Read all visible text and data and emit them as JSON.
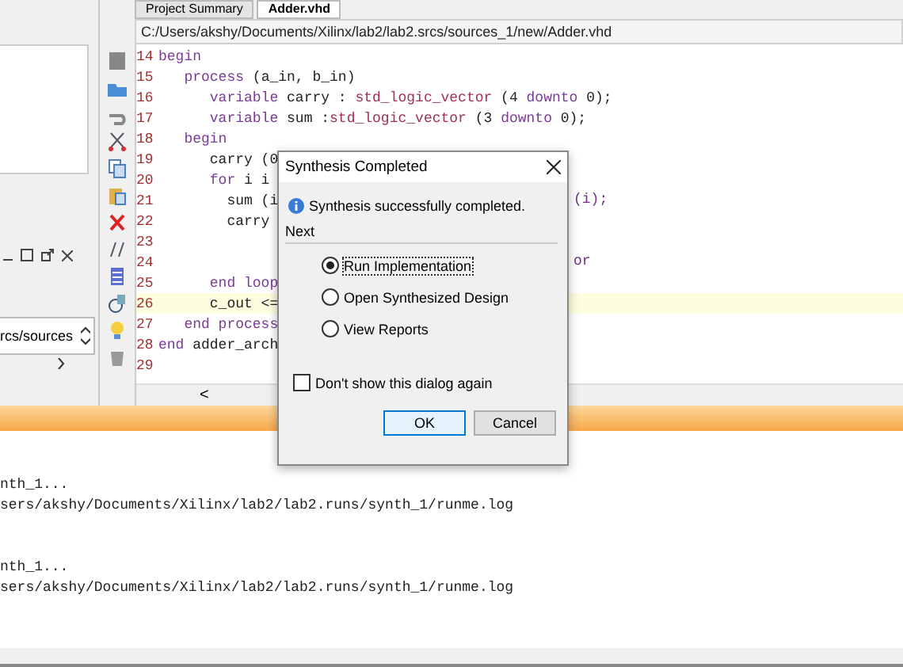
{
  "tabs": [
    {
      "label": "Project Summary",
      "selected": false
    },
    {
      "label": "Adder.vhd",
      "selected": true
    }
  ],
  "left_panel": {
    "field_value": "rcs/sources"
  },
  "editor": {
    "path": "C:/Users/akshy/Documents/Xilinx/lab2/lab2.srcs/sources_1/new/Adder.vhd",
    "lines": [
      {
        "number": "14",
        "highlighted": false,
        "segments": [
          {
            "text": "begin",
            "kind": "keyword"
          }
        ]
      },
      {
        "number": "15",
        "highlighted": false,
        "segments": [
          {
            "text": "   process",
            "kind": "keyword"
          },
          {
            "text": " (a_in, b_in)",
            "kind": "plain"
          }
        ]
      },
      {
        "number": "16",
        "highlighted": false,
        "segments": [
          {
            "text": "      variable",
            "kind": "keyword"
          },
          {
            "text": " carry : ",
            "kind": "plain"
          },
          {
            "text": "std_logic_vector",
            "kind": "type"
          },
          {
            "text": " (4 ",
            "kind": "plain"
          },
          {
            "text": "downto",
            "kind": "keyword"
          },
          {
            "text": " 0);",
            "kind": "plain"
          }
        ]
      },
      {
        "number": "17",
        "highlighted": false,
        "segments": [
          {
            "text": "      variable",
            "kind": "keyword"
          },
          {
            "text": " sum :",
            "kind": "plain"
          },
          {
            "text": "std_logic_vector",
            "kind": "type"
          },
          {
            "text": " (3 ",
            "kind": "plain"
          },
          {
            "text": "downto",
            "kind": "keyword"
          },
          {
            "text": " 0);",
            "kind": "plain"
          }
        ]
      },
      {
        "number": "18",
        "highlighted": false,
        "segments": [
          {
            "text": "   begin",
            "kind": "keyword"
          }
        ]
      },
      {
        "number": "19",
        "highlighted": false,
        "segments": [
          {
            "text": "      carry (0",
            "kind": "plain"
          }
        ]
      },
      {
        "number": "20",
        "highlighted": false,
        "segments": [
          {
            "text": "      for",
            "kind": "keyword"
          },
          {
            "text": " i i",
            "kind": "plain"
          }
        ]
      },
      {
        "number": "21",
        "highlighted": false,
        "segments": [
          {
            "text": "        sum (i",
            "kind": "plain"
          }
        ],
        "tail": "(i);"
      },
      {
        "number": "22",
        "highlighted": false,
        "segments": [
          {
            "text": "        carry",
            "kind": "plain"
          }
        ]
      },
      {
        "number": "23",
        "highlighted": false
      },
      {
        "number": "24",
        "highlighted": false,
        "tail": "or"
      },
      {
        "number": "25",
        "highlighted": false,
        "segments": [
          {
            "text": "      end loop",
            "kind": "keyword"
          }
        ]
      },
      {
        "number": "26",
        "highlighted": true,
        "segments": [
          {
            "text": "      c_out <=",
            "kind": "plain"
          }
        ]
      },
      {
        "number": "27",
        "highlighted": false,
        "segments": [
          {
            "text": "   end process",
            "kind": "keyword"
          }
        ]
      },
      {
        "number": "28",
        "highlighted": false,
        "segments": [
          {
            "text": "end",
            "kind": "keyword"
          },
          {
            "text": " adder_arch",
            "kind": "plain"
          }
        ]
      },
      {
        "number": "29",
        "highlighted": false
      }
    ],
    "scroll_left": "<"
  },
  "log": {
    "entries": [
      {
        "lines": [
          "nth_1...",
          "sers/akshy/Documents/Xilinx/lab2/lab2.runs/synth_1/runme.log"
        ]
      },
      {
        "lines": [
          "nth_1...",
          "sers/akshy/Documents/Xilinx/lab2/lab2.runs/synth_1/runme.log"
        ]
      }
    ]
  },
  "dialog": {
    "title": "Synthesis Completed",
    "message": "Synthesis successfully completed.",
    "group_label": "Next",
    "options": [
      {
        "label": "Run Implementation",
        "selected": true
      },
      {
        "label": "Open Synthesized Design",
        "selected": false
      },
      {
        "label": "View Reports",
        "selected": false
      }
    ],
    "dont_show": {
      "label": "Don't show this dialog again",
      "checked": false
    },
    "buttons": [
      {
        "label": "OK",
        "kind": "primary"
      },
      {
        "label": "Cancel",
        "kind": "secondary"
      }
    ]
  }
}
